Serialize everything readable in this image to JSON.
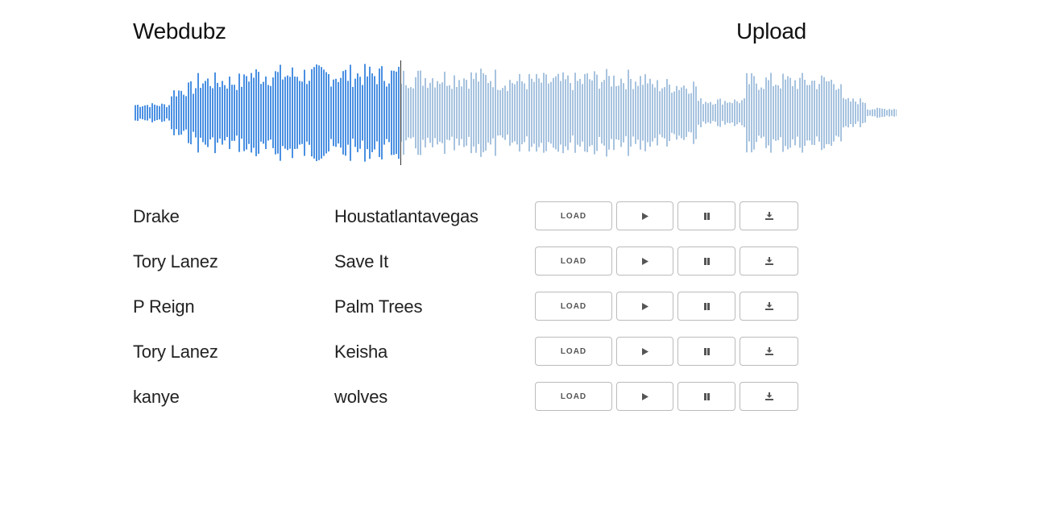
{
  "header": {
    "brand": "Webdubz",
    "upload_label": "Upload"
  },
  "player": {
    "played_color": "#4a90e2",
    "unplayed_color": "#a7c3df",
    "cursor_color": "#333333",
    "progress": 0.35
  },
  "tracks": [
    {
      "artist": "Drake",
      "title": "Houstatlantavegas",
      "load_label": "LOAD"
    },
    {
      "artist": "Tory Lanez",
      "title": "Save It",
      "load_label": "LOAD"
    },
    {
      "artist": "P Reign",
      "title": "Palm Trees",
      "load_label": "LOAD"
    },
    {
      "artist": "Tory Lanez",
      "title": "Keisha",
      "load_label": "LOAD"
    },
    {
      "artist": "kanye",
      "title": "wolves",
      "load_label": "LOAD"
    }
  ],
  "icons": {
    "play": "play-icon",
    "pause": "pause-icon",
    "download": "download-icon"
  }
}
